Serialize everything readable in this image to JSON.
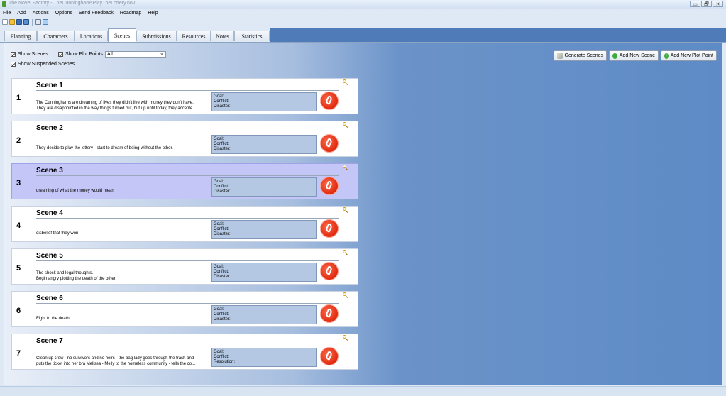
{
  "window": {
    "title": "The Novel Factory - TheCunninghamsPlayTheLottery.nov",
    "controls": [
      "▭",
      "🗗",
      "✕"
    ]
  },
  "menu": [
    "File",
    "Add",
    "Actions",
    "Options",
    "Send Feedback",
    "Roadmap",
    "Help"
  ],
  "toolbar": [
    "new-file-icon",
    "open-folder-icon",
    "save-icon",
    "save-as-icon",
    "print-icon",
    "export-icon"
  ],
  "tabs": [
    {
      "label": "Planning",
      "active": false
    },
    {
      "label": "Characters",
      "active": false
    },
    {
      "label": "Locations",
      "active": false
    },
    {
      "label": "Scenes",
      "active": true
    },
    {
      "label": "Submissions",
      "active": false
    },
    {
      "label": "Resources",
      "active": false
    },
    {
      "label": "Notes",
      "active": false
    },
    {
      "label": "Statistics",
      "active": false
    }
  ],
  "filters": {
    "show_scenes": {
      "label": "Show Scenes",
      "checked": true
    },
    "show_plot_points": {
      "label": "Show Plot Points",
      "checked": true
    },
    "show_suspended": {
      "label": "Show Suspended Scenes",
      "checked": true
    },
    "dropdown": {
      "value": "All"
    }
  },
  "actions": {
    "generate": "Generate Scenes",
    "add_scene": "Add New Scene",
    "add_plot_point": "Add New Plot Point"
  },
  "scenes": [
    {
      "number": "1",
      "title": "Scene 1",
      "desc": [
        "The Cunninghams are dreaming of lives they didn't live with money they don't have.",
        "They are disappointed in the way things turned out, but up until today, they accepte..."
      ],
      "fields": [
        "Goal:",
        "Conflict:",
        "Disaster:"
      ],
      "selected": false
    },
    {
      "number": "2",
      "title": "Scene 2",
      "desc": [
        "They decide to play the lottery  - start to dream of being without the other."
      ],
      "fields": [
        "Goal:",
        "Conflict:",
        "Disaster:"
      ],
      "selected": false
    },
    {
      "number": "3",
      "title": "Scene 3",
      "desc": [
        "dreaming of what the money would mean"
      ],
      "fields": [
        "Goal:",
        "Conflict:",
        "Disaster:"
      ],
      "selected": true
    },
    {
      "number": "4",
      "title": "Scene 4",
      "desc": [
        "disbelief that they won"
      ],
      "fields": [
        "Goal:",
        "Conflict:",
        "Disaster:"
      ],
      "selected": false
    },
    {
      "number": "5",
      "title": "Scene 5",
      "desc": [
        "The shock and legal thoughts.",
        "Begin angry plotting the death of the other"
      ],
      "fields": [
        "Goal:",
        "Conflict:",
        "Disaster:"
      ],
      "selected": false
    },
    {
      "number": "6",
      "title": "Scene 6",
      "desc": [
        "Fight to the death"
      ],
      "fields": [
        "Goal:",
        "Conflict:",
        "Disaster:"
      ],
      "selected": false
    },
    {
      "number": "7",
      "title": "Scene 7",
      "desc": [
        "Clean up crew - no survivors and no heirs - the bag lady goes through the trash and",
        "puts the ticket into her bra Melissa - Melly to the homeless community - tells the co..."
      ],
      "fields": [
        "Goal:",
        "Conflict:",
        "Resolution:"
      ],
      "selected": false
    }
  ],
  "colors": {
    "accent": "#4f7bb8",
    "selected_scene": "#c4c6f7",
    "gcd_box": "#b4c8e4"
  }
}
